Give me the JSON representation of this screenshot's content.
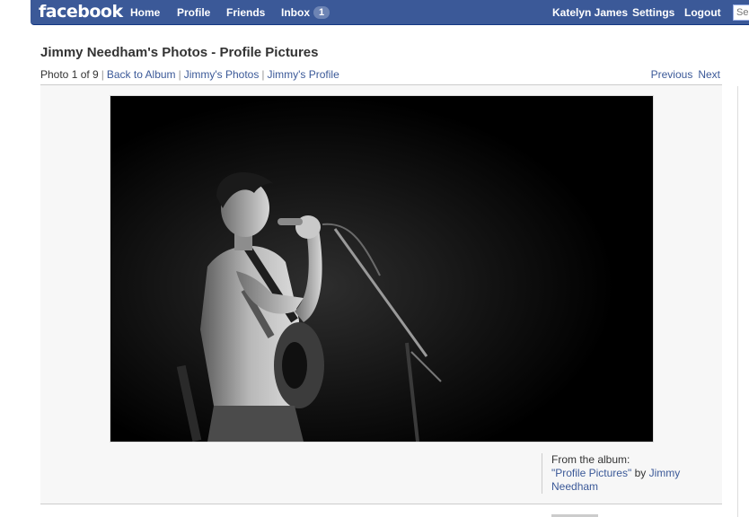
{
  "nav": {
    "logo": "facebook",
    "home": "Home",
    "profile": "Profile",
    "friends": "Friends",
    "inbox": "Inbox",
    "inbox_count": "1",
    "user": "Katelyn James",
    "settings": "Settings",
    "logout": "Logout",
    "search_placeholder": "Search"
  },
  "page": {
    "title": "Jimmy Needham's Photos - Profile Pictures",
    "photo_counter": "Photo 1 of 9",
    "back_to_album": "Back to Album",
    "owner_photos": "Jimmy's Photos",
    "owner_profile": "Jimmy's Profile",
    "previous": "Previous",
    "next": "Next"
  },
  "album_info": {
    "from_label": "From the album:",
    "album_name": "\"Profile Pictures\"",
    "by": "by",
    "owner": "Jimmy Needham"
  },
  "colors": {
    "brand": "#3b5998",
    "photo_background": "#000000"
  }
}
